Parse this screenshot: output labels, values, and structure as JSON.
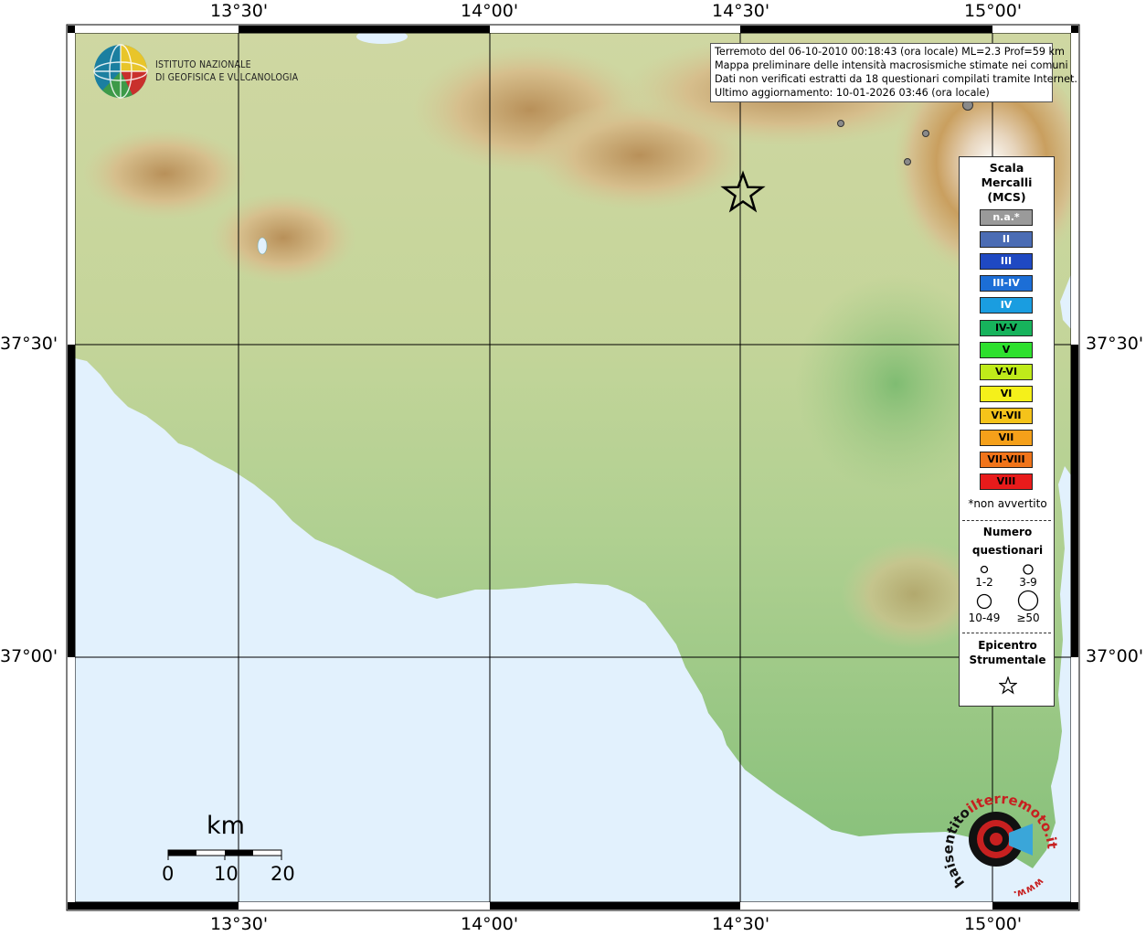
{
  "map": {
    "top_axis_labels": [
      "13°30'",
      "14°00'",
      "14°30'",
      "15°00'"
    ],
    "bottom_axis_labels": [
      "13°30'",
      "14°00'",
      "14°30'",
      "15°00'"
    ],
    "left_axis_labels": [
      "37°30'",
      "37°00'"
    ],
    "right_axis_labels": [
      "37°30'",
      "37°00'"
    ]
  },
  "logo": {
    "line1": "ISTITUTO NAZIONALE",
    "line2": "DI GEOFISICA E VULCANOLOGIA"
  },
  "info": {
    "line1": "Terremoto del 06-10-2010 00:18:43 (ora locale) ML=2.3 Prof=59 km",
    "line2": "Mappa preliminare delle intensità macrosismiche stimate nei comuni",
    "line3": "Dati non verificati estratti da 18 questionari compilati tramite Internet.",
    "line4": "Ultimo aggiornamento: 10-01-2026 03:46 (ora locale)"
  },
  "legend": {
    "title_line1": "Scala",
    "title_line2": "Mercalli",
    "title_line3": "(MCS)",
    "items": [
      {
        "label": "n.a.*",
        "color": "#9a9a9a",
        "text_color": "#ffffff"
      },
      {
        "label": "II",
        "color": "#4b6cb4",
        "text_color": "#ffffff"
      },
      {
        "label": "III",
        "color": "#1f49c2",
        "text_color": "#ffffff"
      },
      {
        "label": "III-IV",
        "color": "#1c6ed6",
        "text_color": "#ffffff"
      },
      {
        "label": "IV",
        "color": "#1a9de0",
        "text_color": "#ffffff"
      },
      {
        "label": "IV-V",
        "color": "#17b35c",
        "text_color": "#000000"
      },
      {
        "label": "V",
        "color": "#2ee02e",
        "text_color": "#000000"
      },
      {
        "label": "V-VI",
        "color": "#bfeb1a",
        "text_color": "#000000"
      },
      {
        "label": "VI",
        "color": "#f5f01a",
        "text_color": "#000000"
      },
      {
        "label": "VI-VII",
        "color": "#f5c31a",
        "text_color": "#000000"
      },
      {
        "label": "VII",
        "color": "#f5a01a",
        "text_color": "#000000"
      },
      {
        "label": "VII-VIII",
        "color": "#f0741a",
        "text_color": "#000000"
      },
      {
        "label": "VIII",
        "color": "#e81b1b",
        "text_color": "#000000"
      }
    ],
    "not_felt_note": "*non avvertito",
    "questionnaires_line1": "Numero",
    "questionnaires_line2": "questionari",
    "circle_labels": [
      "1-2",
      "3-9",
      "10-49",
      "≥50"
    ],
    "epicenter_line1": "Epicentro",
    "epicenter_line2": "Strumentale"
  },
  "scalebar": {
    "title": "km",
    "labels": [
      "0",
      "10",
      "20"
    ]
  },
  "watermark": {
    "text_black": "haisentito",
    "text_red_1": "ilterremoto.it",
    "text_red_2": "www."
  },
  "colors": {
    "sea": "#e2f1fd",
    "land_low": "#8fc680",
    "land_mid": "#cdd8a0",
    "hills": "#d8be8a",
    "mountains": "#b48c55",
    "peak": "#f4f1ee"
  }
}
